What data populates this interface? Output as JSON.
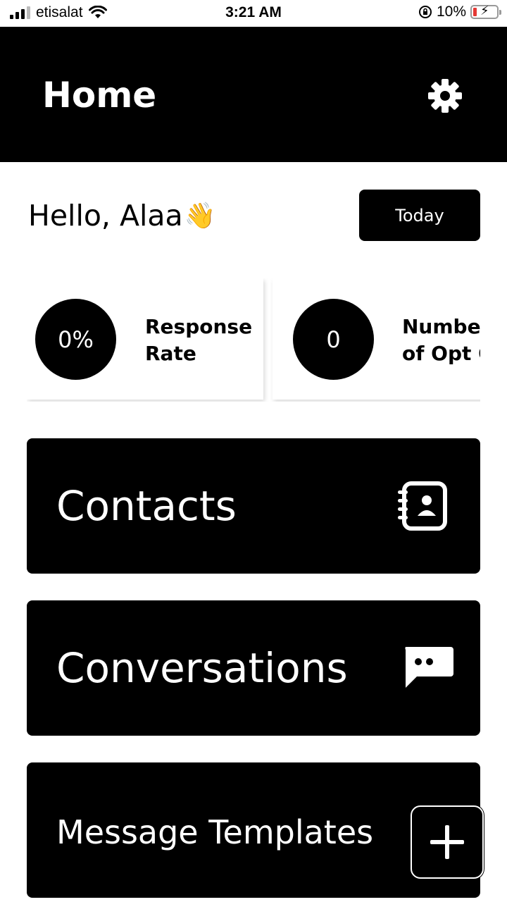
{
  "status_bar": {
    "carrier": "etisalat",
    "time": "3:21 AM",
    "battery": "10%",
    "icons": [
      "signal-icon",
      "wifi-icon",
      "orientation-lock-icon",
      "battery-charging-icon"
    ]
  },
  "header": {
    "title": "Home",
    "settings_icon": "gear-icon"
  },
  "greeting": {
    "text": "Hello, Alaa",
    "emoji": "👋"
  },
  "period_button": {
    "label": "Today"
  },
  "stats": [
    {
      "value": "0%",
      "label": "Response\nRate"
    },
    {
      "value": "0",
      "label": "Number\nof Opt O"
    }
  ],
  "nav": {
    "contacts": {
      "label": "Contacts",
      "icon": "contacts-book-icon"
    },
    "conversations": {
      "label": "Conversations",
      "icon": "chat-bubble-icon"
    },
    "templates": {
      "label": "Message Templates",
      "icon": "template-icon"
    }
  },
  "fab": {
    "icon": "plus-icon"
  },
  "colors": {
    "primary": "#000000",
    "background": "#ffffff",
    "on_primary": "#ffffff"
  }
}
